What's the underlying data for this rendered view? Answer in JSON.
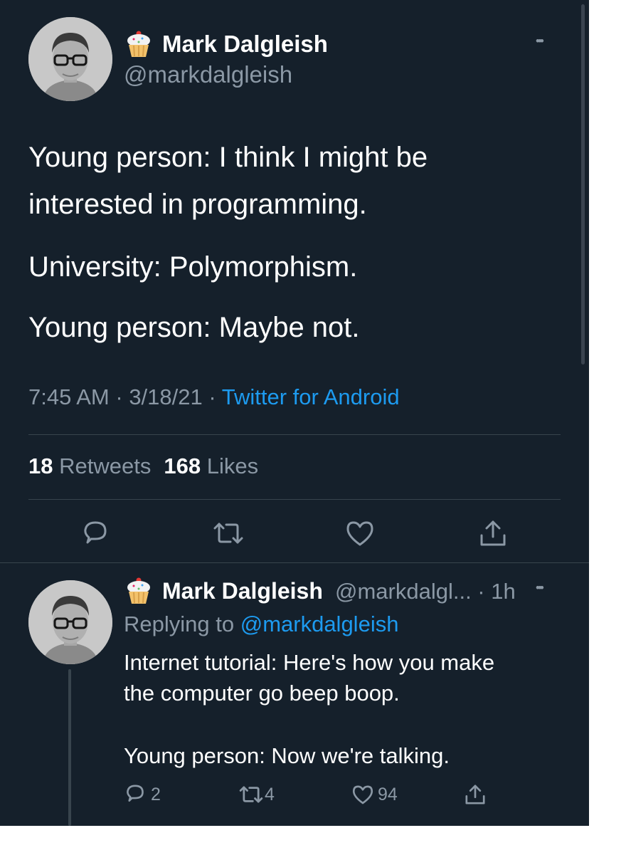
{
  "main_tweet": {
    "display_name": "Mark Dalgleish",
    "handle": "@markdalgleish",
    "more": "•••",
    "lines": [
      "Young person: I think I might be",
      "interested in programming.",
      "University: Polymorphism.",
      "Young person: Maybe not."
    ],
    "time": "7:45 AM",
    "date": "3/18/21",
    "sep": " · ",
    "source": "Twitter for Android",
    "retweets_count": "18",
    "retweets_label": "Retweets",
    "likes_count": "168",
    "likes_label": "Likes"
  },
  "reply_tweet": {
    "display_name": "Mark Dalgleish",
    "handle_time": "@markdalgl... · 1h",
    "more": "•••",
    "replying_prefix": "Replying to ",
    "replying_handle": "@markdalgleish",
    "lines": [
      "Internet tutorial: Here's how you make",
      "the computer go beep boop.",
      "Young person: Now we're talking."
    ],
    "reply_count": "2",
    "retweet_count": "4",
    "like_count": "94"
  },
  "icons": [
    "cupcake-icon",
    "reply-icon",
    "retweet-icon",
    "like-icon",
    "share-icon",
    "more-icon"
  ],
  "colors": {
    "background": "#15202b",
    "text": "#ffffff",
    "muted": "#8b98a5",
    "link": "#1d9bf0",
    "divider": "#38444d"
  }
}
